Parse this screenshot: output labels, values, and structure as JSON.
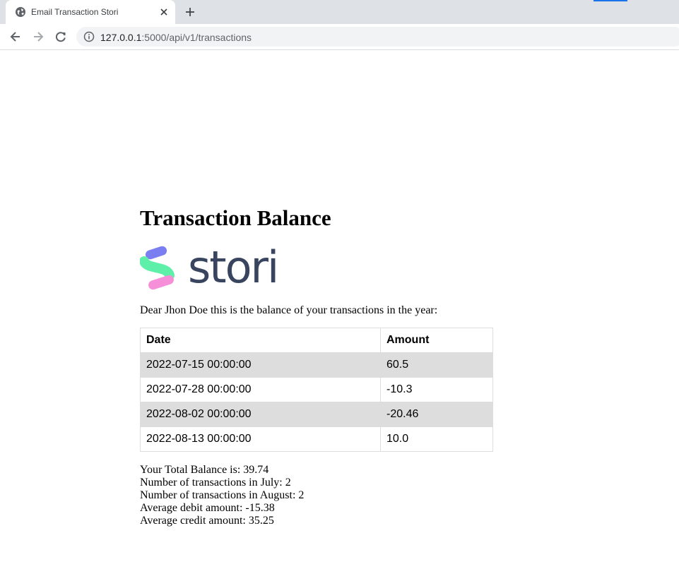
{
  "browser": {
    "tab_title": "Email Transaction Stori",
    "url_host": "127.0.0.1",
    "url_path": ":5000/api/v1/transactions"
  },
  "page": {
    "title": "Transaction Balance",
    "logo_text": "stori",
    "greeting": "Dear Jhon Doe this is the balance of your transactions in the year:"
  },
  "table": {
    "headers": [
      "Date",
      "Amount"
    ],
    "rows": [
      {
        "date": "2022-07-15 00:00:00",
        "amount": "60.5"
      },
      {
        "date": "2022-07-28 00:00:00",
        "amount": "-10.3"
      },
      {
        "date": "2022-08-02 00:00:00",
        "amount": "-20.46"
      },
      {
        "date": "2022-08-13 00:00:00",
        "amount": "10.0"
      }
    ]
  },
  "summary": {
    "total_balance": "Your Total Balance is: 39.74",
    "july_count": "Number of transactions in July: 2",
    "august_count": "Number of transactions in August: 2",
    "avg_debit": "Average debit amount: -15.38",
    "avg_credit": "Average credit amount: 35.25"
  },
  "colors": {
    "logo_text": "#39455f",
    "logo_purple": "#7b7ef0",
    "logo_green": "#5ef0a8",
    "logo_pink": "#f48fd8",
    "row_alt": "#dddddd"
  },
  "icons": [
    "globe-icon",
    "close-icon",
    "plus-icon",
    "back-arrow-icon",
    "forward-arrow-icon",
    "reload-icon",
    "info-icon"
  ]
}
